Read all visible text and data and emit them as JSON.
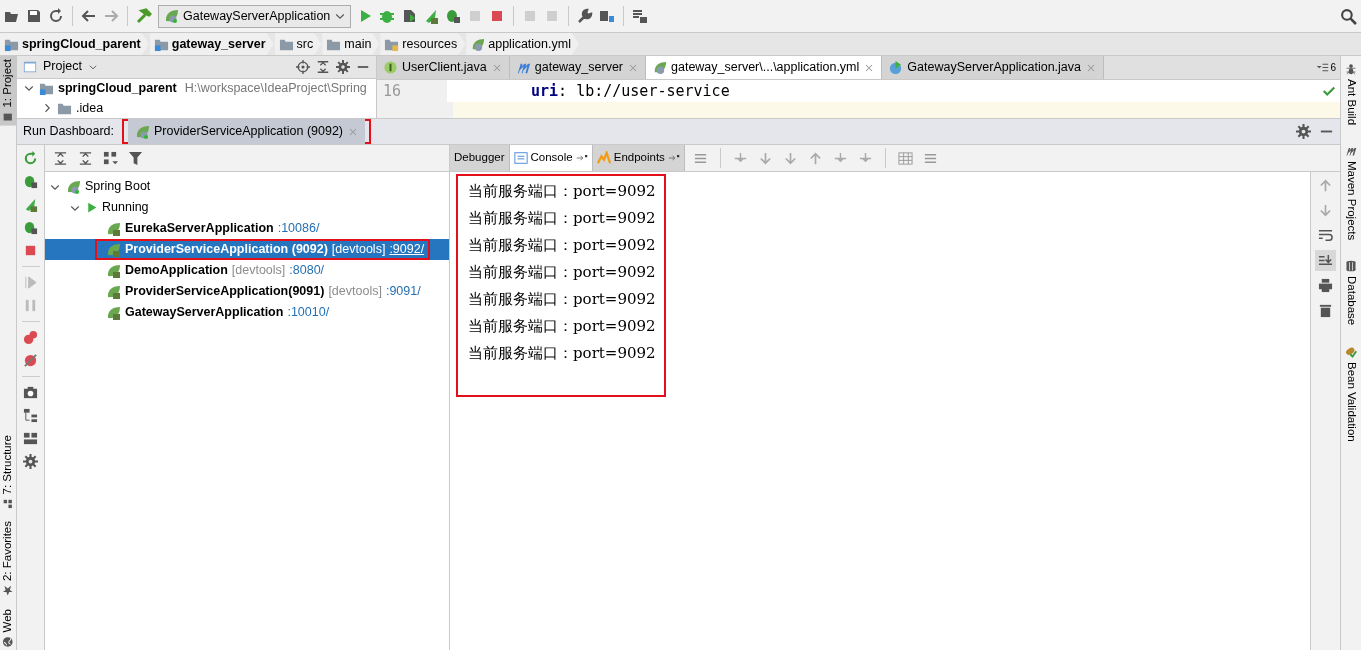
{
  "toolbar": {
    "run_config": "GatewayServerApplication"
  },
  "breadcrumbs": [
    {
      "label": "springCloud_parent",
      "kind": "module"
    },
    {
      "label": "gateway_server",
      "kind": "module"
    },
    {
      "label": "src",
      "kind": "folder"
    },
    {
      "label": "main",
      "kind": "folder"
    },
    {
      "label": "resources",
      "kind": "resources"
    },
    {
      "label": "application.yml",
      "kind": "yml"
    }
  ],
  "left_stripe": [
    {
      "label": "1: Project",
      "kind": "project",
      "selected": true
    },
    {
      "label": "7: Structure",
      "kind": "structure",
      "selected": false
    },
    {
      "label": "2: Favorites",
      "kind": "favorites",
      "selected": false
    },
    {
      "label": "Web",
      "kind": "web",
      "selected": false
    }
  ],
  "right_stripe": [
    {
      "label": "Ant Build",
      "kind": "ant"
    },
    {
      "label": "Maven Projects",
      "kind": "maven"
    },
    {
      "label": "Database",
      "kind": "database"
    },
    {
      "label": "Bean Validation",
      "kind": "bean"
    }
  ],
  "project_panel": {
    "title": "Project",
    "items": [
      {
        "name": "springCloud_parent",
        "path": "H:\\workspace\\IdeaProject\\Spring",
        "expanded": true,
        "children": [
          {
            "name": ".idea",
            "expanded": false
          }
        ]
      }
    ]
  },
  "editor": {
    "tabs": [
      {
        "label": "UserClient.java",
        "kind": "interface",
        "selected": false
      },
      {
        "label": "gateway_server",
        "kind": "maven",
        "selected": false
      },
      {
        "label": "gateway_server\\...\\application.yml",
        "kind": "yml",
        "selected": true
      },
      {
        "label": "GatewayServerApplication.java",
        "kind": "boot",
        "selected": false
      }
    ],
    "hidden_tabs": "6",
    "lines": [
      {
        "number": "16",
        "key": "uri",
        "value": ": lb://user-service"
      }
    ]
  },
  "run_dashboard": {
    "title": "Run Dashboard:",
    "tabs": [
      {
        "label": "ProviderServiceApplication (9092)",
        "selected": true,
        "highlighted": true
      }
    ],
    "tree": [
      {
        "label": "Spring Boot",
        "kind": "group",
        "expanded": true,
        "children": [
          {
            "label": "Running",
            "kind": "status",
            "expanded": true,
            "children": [
              {
                "name": "EurekaServerApplication",
                "port": ":10086/",
                "selected": false,
                "highlighted": false
              },
              {
                "name": "ProviderServiceApplication (9092)",
                "tag": "[devtools]",
                "port": ":9092/",
                "selected": true,
                "highlighted": true
              },
              {
                "name": "DemoApplication",
                "tag": "[devtools]",
                "port": ":8080/",
                "selected": false,
                "highlighted": false
              },
              {
                "name": "ProviderServiceApplication(9091)",
                "tag": "[devtools]",
                "port": ":9091/",
                "selected": false,
                "highlighted": false
              },
              {
                "name": "GatewayServerApplication",
                "port": ":10010/",
                "selected": false,
                "highlighted": false
              }
            ]
          }
        ]
      }
    ],
    "console": {
      "tabs": [
        {
          "label": "Debugger",
          "kind": "debugger",
          "selected": false
        },
        {
          "label": "Console",
          "kind": "console",
          "selected": true
        },
        {
          "label": "Endpoints",
          "kind": "endpoints",
          "selected": false
        }
      ],
      "highlighted": true,
      "lines": [
        "当前服务端口：port=9092",
        "当前服务端口：port=9092",
        "当前服务端口：port=9092",
        "当前服务端口：port=9092",
        "当前服务端口：port=9092",
        "当前服务端口：port=9092",
        "当前服务端口：port=9092"
      ]
    }
  }
}
